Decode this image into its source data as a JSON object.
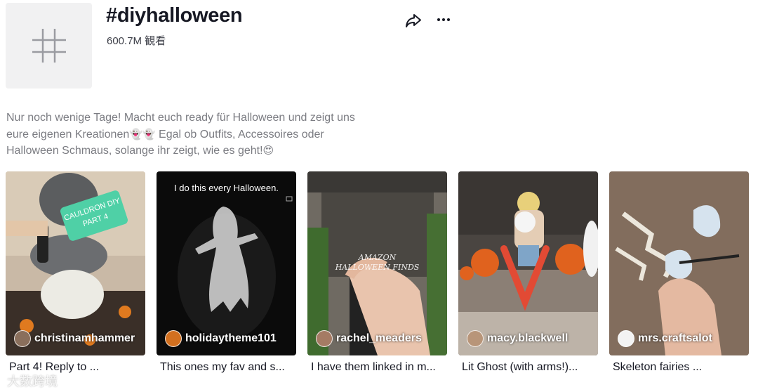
{
  "header": {
    "title": "#diyhalloween",
    "views": "600.7M 観看"
  },
  "description": {
    "line1": "Nur noch wenige Tage! Macht euch ready für Halloween und zeigt uns",
    "line2_a": "eure eigenen Kreationen",
    "line2_emoji": "👻👻",
    "line2_b": " Egal ob Outfits, Accessoires oder",
    "line3_a": "Halloween Schmaus, solange ihr zeigt, wie es geht!",
    "line3_emoji": "😍"
  },
  "videos": [
    {
      "author": "christinamhammer",
      "caption": "Part 4! Reply to ...",
      "overlay": "CAULDRON DIY\nPART 4"
    },
    {
      "author": "holidaytheme101",
      "caption": "This ones my fav and s...",
      "overlay": "I do this every Halloween."
    },
    {
      "author": "rachel_meaders",
      "caption": "I have them linked in m...",
      "overlay": "AMAZON\nHALLOWEEN FINDS"
    },
    {
      "author": "macy.blackwell",
      "caption": "Lit Ghost (with arms!)...",
      "overlay": ""
    },
    {
      "author": "mrs.craftsalot",
      "caption": "Skeleton fairies ...",
      "overlay": ""
    }
  ],
  "watermark": "大数跨境",
  "colors": {
    "text": "#161823",
    "secondary": "#7b7c82",
    "avatar_bg": "#f1f1f2"
  }
}
